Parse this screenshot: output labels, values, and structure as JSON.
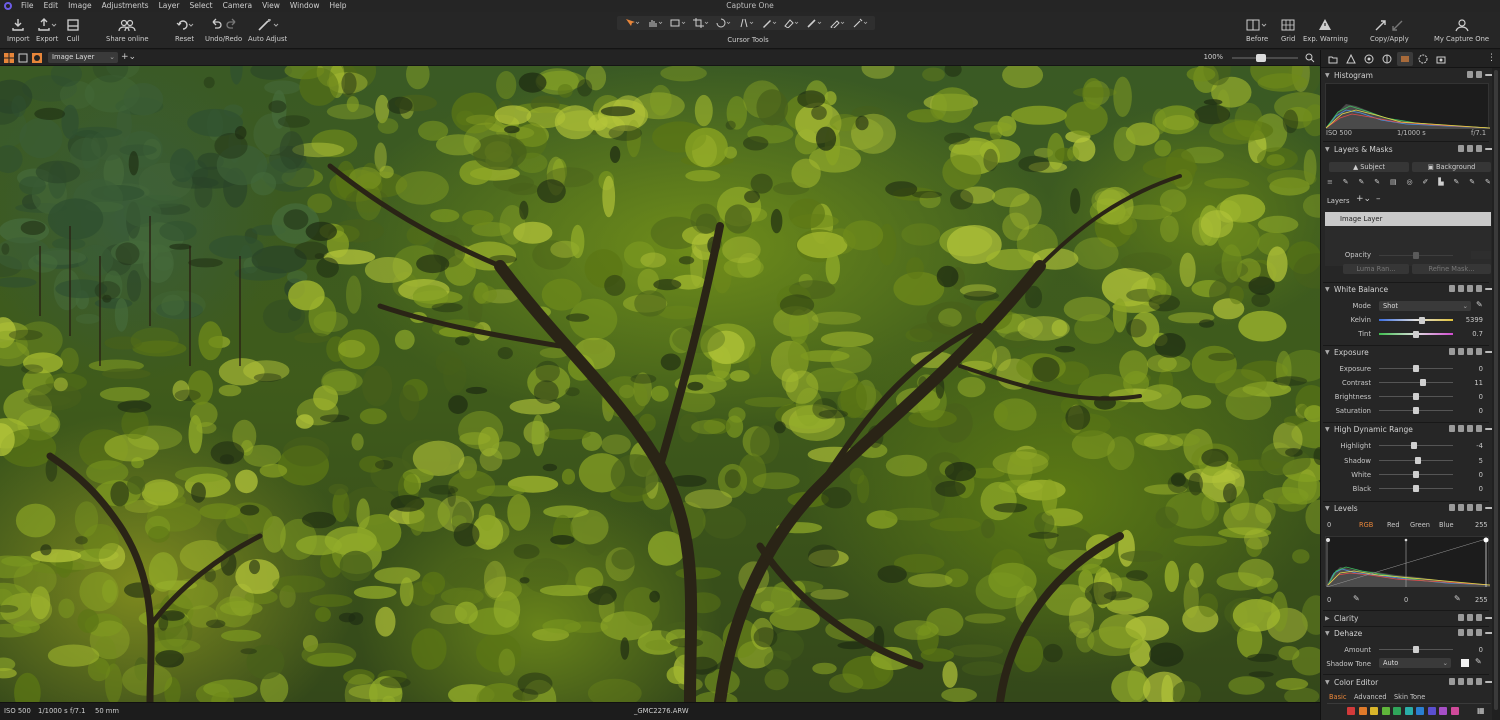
{
  "app": {
    "title": "Capture One"
  },
  "menu": [
    "File",
    "Edit",
    "Image",
    "Adjustments",
    "Layer",
    "Select",
    "Camera",
    "View",
    "Window",
    "Help"
  ],
  "toolbar": {
    "import": "Import",
    "export": "Export",
    "cull": "Cull",
    "share_online": "Share online",
    "reset": "Reset",
    "undo_redo": "Undo/Redo",
    "auto_adjust": "Auto Adjust",
    "cursor_tools": "Cursor Tools",
    "before": "Before",
    "grid": "Grid",
    "exp_warning": "Exp. Warning",
    "copy_apply": "Copy/Apply",
    "my_capture_one": "My Capture One"
  },
  "viewer": {
    "layer_select": "Image Layer",
    "zoom": "100%",
    "zoom_level": 0.42
  },
  "status": {
    "iso": "ISO 500",
    "shutter": "1/1000 s",
    "aperture": "f/7.1",
    "focal": "50 mm",
    "filename": "_GMC2276.ARW"
  },
  "histogram": {
    "title": "Histogram",
    "iso": "ISO 500",
    "shutter": "1/1000 s",
    "aperture": "f/7.1"
  },
  "layers_masks": {
    "title": "Layers & Masks",
    "subject": "Subject",
    "background": "Background",
    "layers_label": "Layers",
    "image_layer": "Image Layer",
    "opacity": "Opacity",
    "luma_range": "Luma Ran...",
    "refine_mask": "Refine Mask..."
  },
  "white_balance": {
    "title": "White Balance",
    "mode_label": "Mode",
    "mode_value": "Shot",
    "kelvin_label": "Kelvin",
    "kelvin": "5399",
    "tint_label": "Tint",
    "tint": "0.7"
  },
  "exposure": {
    "title": "Exposure",
    "exposure_label": "Exposure",
    "exposure": "0",
    "contrast_label": "Contrast",
    "contrast": "11",
    "brightness_label": "Brightness",
    "brightness": "0",
    "saturation_label": "Saturation",
    "saturation": "0"
  },
  "hdr": {
    "title": "High Dynamic Range",
    "highlight_label": "Highlight",
    "highlight": "-4",
    "shadow_label": "Shadow",
    "shadow": "5",
    "white_label": "White",
    "white": "0",
    "black_label": "Black",
    "black": "0"
  },
  "levels": {
    "title": "Levels",
    "in_low": "0",
    "in_high": "255",
    "channels": [
      "RGB",
      "Red",
      "Green",
      "Blue"
    ],
    "active_channel": "RGB",
    "out_low": "0",
    "mid": "0",
    "out_high": "255"
  },
  "clarity": {
    "title": "Clarity"
  },
  "dehaze": {
    "title": "Dehaze",
    "amount_label": "Amount",
    "amount": "0",
    "shadow_tone_label": "Shadow Tone",
    "shadow_tone": "Auto"
  },
  "color_editor": {
    "title": "Color Editor",
    "tabs": [
      "Basic",
      "Advanced",
      "Skin Tone"
    ],
    "active_tab": "Basic",
    "swatches": [
      "#d23a3a",
      "#e07a2a",
      "#d9b52a",
      "#5fb53a",
      "#2fa55a",
      "#2aaea8",
      "#2a7fd0",
      "#5a4fd0",
      "#a64fc6",
      "#d04a9a"
    ]
  },
  "colors": {
    "accent": "#e8863a",
    "panel": "#262626",
    "bg": "#1e1e1e"
  }
}
